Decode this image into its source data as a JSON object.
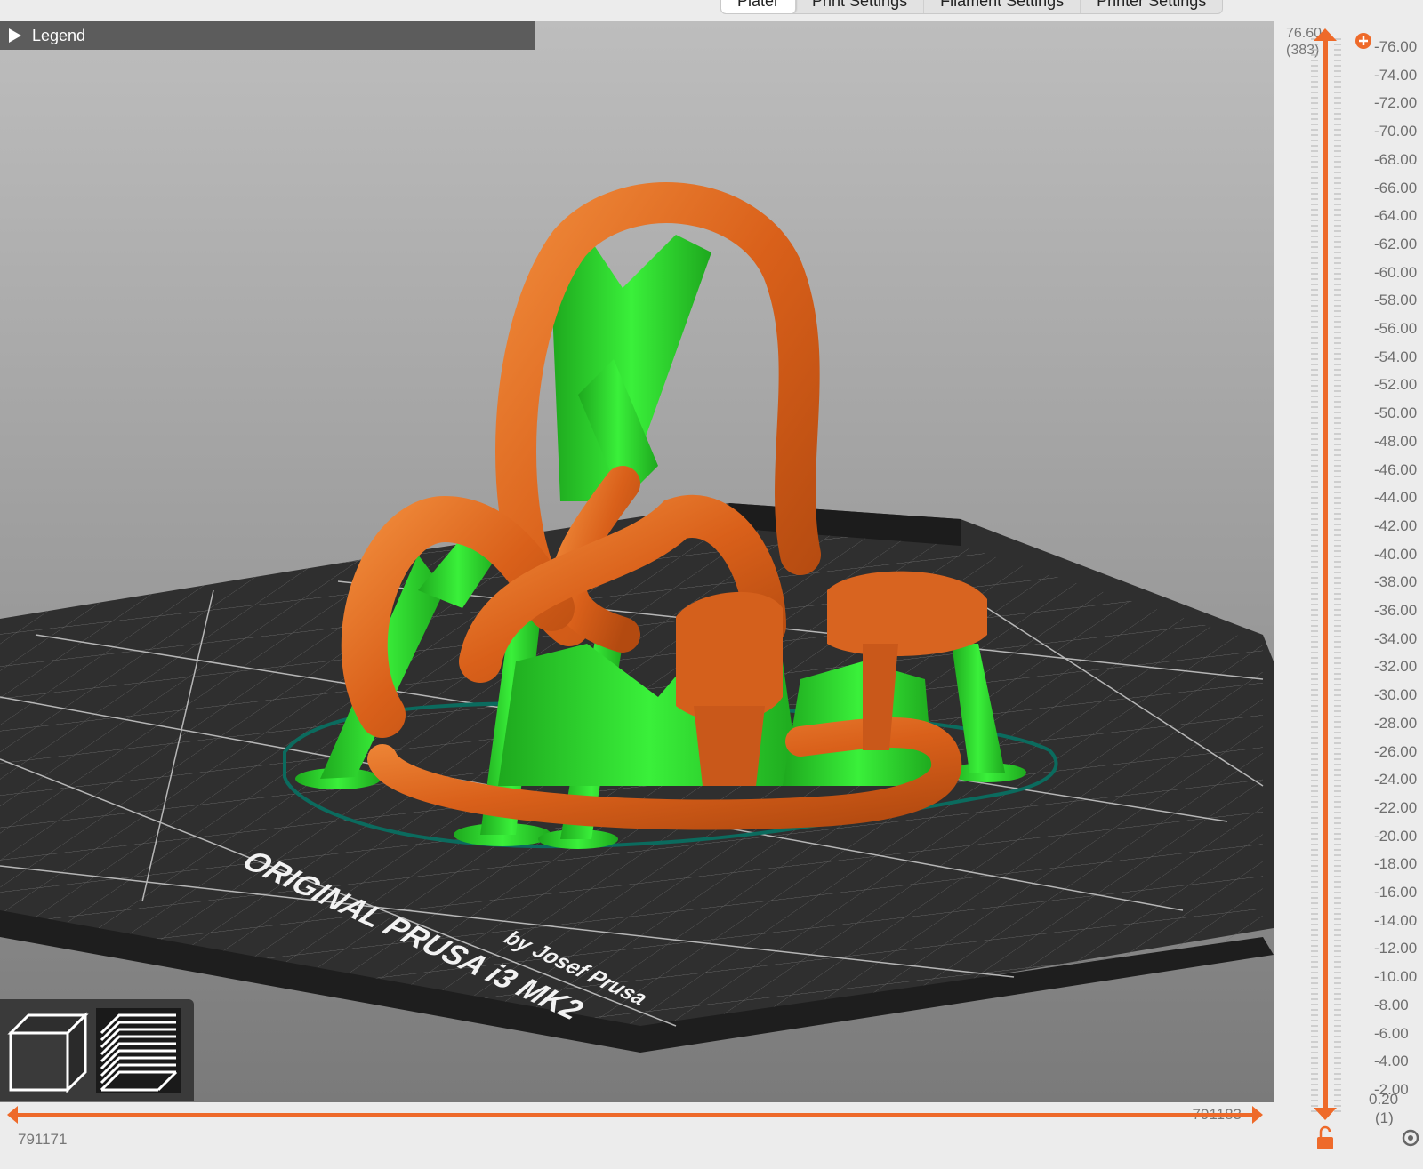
{
  "tabs": [
    {
      "label": "Plater"
    },
    {
      "label": "Print Settings"
    },
    {
      "label": "Filament Settings"
    },
    {
      "label": "Printer Settings"
    }
  ],
  "legend": {
    "label": "Legend"
  },
  "bed_text": {
    "line1": "ORIGINAL PRUSA i3 MK2",
    "line2": "by Josef Prusa"
  },
  "vertical_slider": {
    "top_value": "76.60",
    "top_layer": "(383)",
    "ticks": [
      "76.00",
      "74.00",
      "72.00",
      "70.00",
      "68.00",
      "66.00",
      "64.00",
      "62.00",
      "60.00",
      "58.00",
      "56.00",
      "54.00",
      "52.00",
      "50.00",
      "48.00",
      "46.00",
      "44.00",
      "42.00",
      "40.00",
      "38.00",
      "36.00",
      "34.00",
      "32.00",
      "30.00",
      "28.00",
      "26.00",
      "24.00",
      "22.00",
      "20.00",
      "18.00",
      "16.00",
      "14.00",
      "12.00",
      "10.00",
      "8.00",
      "6.00",
      "4.00",
      "2.00"
    ],
    "bottom_value": "0.20",
    "bottom_layer": "(1)",
    "accent_color": "#ee6a2a"
  },
  "horizontal_slider": {
    "right_value": "791183",
    "left_value": "791171",
    "accent_color": "#ee6a2a"
  },
  "colors": {
    "perimeter": "#e06a1e",
    "support": "#22d022",
    "bed": "#2f2f2f",
    "background_top": "#b4b4b4",
    "background_bottom": "#6e6e6e"
  },
  "view_toggle": {
    "icons": [
      "3d-view-icon",
      "layers-view-icon"
    ]
  }
}
